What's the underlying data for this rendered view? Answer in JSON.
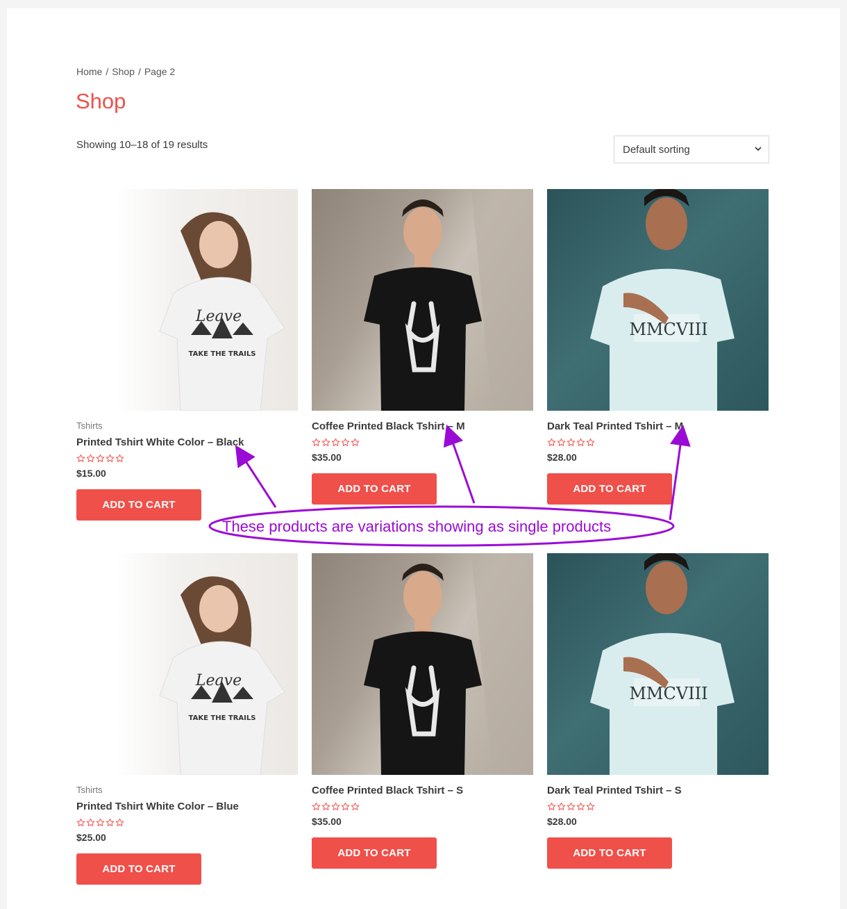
{
  "breadcrumb": {
    "home": "Home",
    "shop": "Shop",
    "current": "Page 2",
    "separator": "/"
  },
  "page_title": "Shop",
  "result_count": "Showing 10–18 of 19 results",
  "sorting": {
    "selected": "Default sorting"
  },
  "rating_color": "#f0504a",
  "button_color": "#f0504a",
  "products": [
    {
      "category": "Tshirts",
      "name": "Printed Tshirt White Color – Black",
      "price": "$15.00",
      "rating": 0,
      "button": "ADD TO CART",
      "image": "woman-white-tshirt"
    },
    {
      "category": "",
      "name": "Coffee Printed Black Tshirt – M",
      "price": "$35.00",
      "rating": 0,
      "button": "ADD TO CART",
      "image": "man-black-tshirt"
    },
    {
      "category": "",
      "name": "Dark Teal Printed Tshirt – M",
      "price": "$28.00",
      "rating": 0,
      "button": "ADD TO CART",
      "image": "man-teal-tshirt"
    },
    {
      "category": "Tshirts",
      "name": "Printed Tshirt White Color – Blue",
      "price": "$25.00",
      "rating": 0,
      "button": "ADD TO CART",
      "image": "woman-white-tshirt"
    },
    {
      "category": "",
      "name": "Coffee Printed Black Tshirt – S",
      "price": "$35.00",
      "rating": 0,
      "button": "ADD TO CART",
      "image": "man-black-tshirt"
    },
    {
      "category": "",
      "name": "Dark Teal Printed Tshirt – S",
      "price": "$28.00",
      "rating": 0,
      "button": "ADD TO CART",
      "image": "man-teal-tshirt"
    }
  ],
  "annotation": {
    "text": "These products are variations showing as single products",
    "color": "#9b0bd6"
  }
}
